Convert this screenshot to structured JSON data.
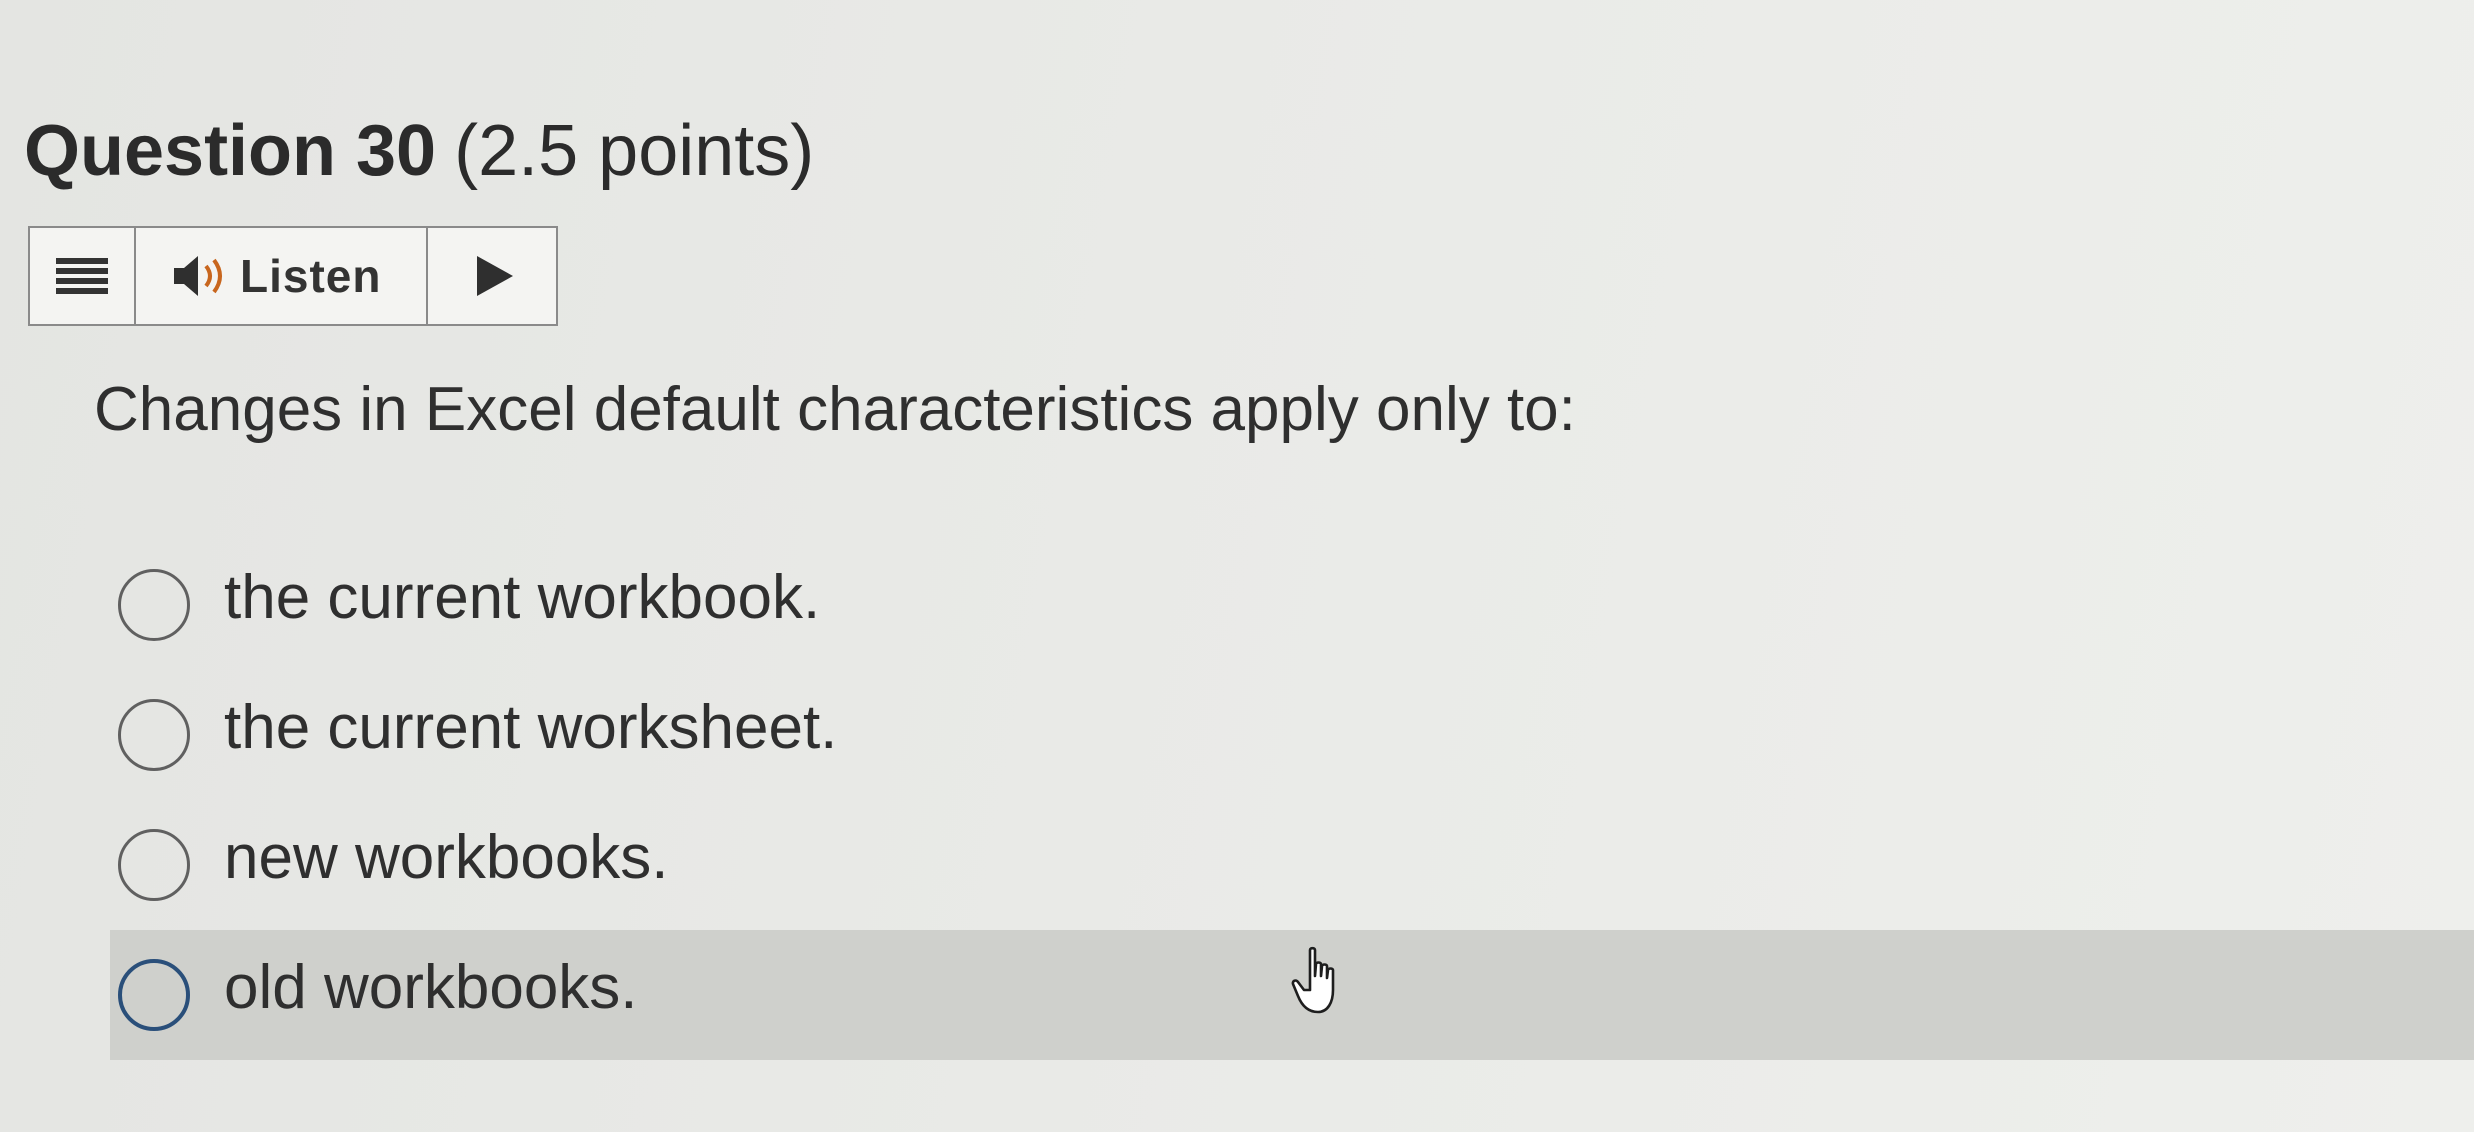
{
  "question": {
    "label": "Question 30",
    "points": "(2.5 points)",
    "text": "Changes in Excel default characteristics apply only to:"
  },
  "toolbar": {
    "menu_icon": "menu-icon",
    "listen_label": "Listen",
    "speaker_icon": "speaker-icon",
    "play_icon": "play-icon"
  },
  "options": [
    {
      "label": "the current workbook.",
      "selected": false
    },
    {
      "label": "the current worksheet.",
      "selected": false
    },
    {
      "label": "new workbooks.",
      "selected": false
    },
    {
      "label": "old workbooks.",
      "selected": false,
      "hovered": true
    }
  ],
  "colors": {
    "hover_row": "#cfd0cc",
    "hover_radio": "#2a4f7a",
    "text": "#2f2f2f"
  }
}
